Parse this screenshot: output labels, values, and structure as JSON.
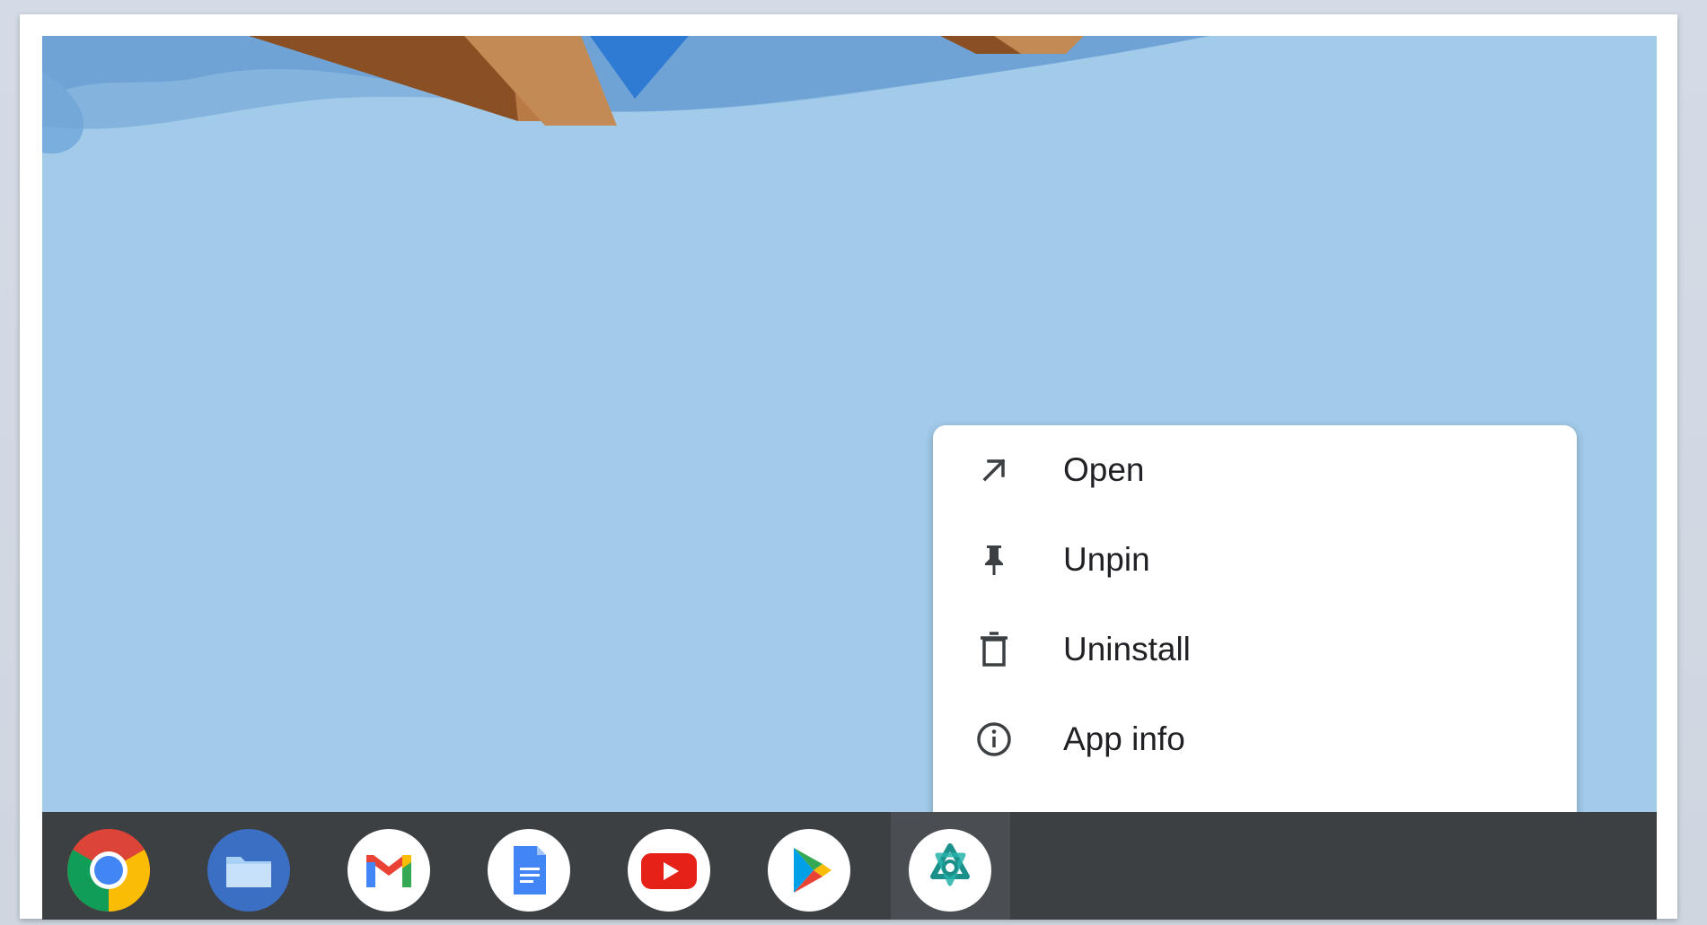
{
  "context_menu": {
    "items": [
      {
        "label": "Open",
        "icon": "open-arrow-icon"
      },
      {
        "label": "Unpin",
        "icon": "pin-icon"
      },
      {
        "label": "Uninstall",
        "icon": "trash-icon"
      },
      {
        "label": "App info",
        "icon": "info-icon"
      }
    ]
  },
  "shelf": {
    "apps": [
      {
        "name": "Chrome",
        "icon": "chrome-icon"
      },
      {
        "name": "Files",
        "icon": "files-icon"
      },
      {
        "name": "Gmail",
        "icon": "gmail-icon"
      },
      {
        "name": "Docs",
        "icon": "docs-icon"
      },
      {
        "name": "YouTube",
        "icon": "youtube-icon"
      },
      {
        "name": "Play Store",
        "icon": "play-store-icon"
      },
      {
        "name": "Selected app",
        "icon": "knot-app-icon"
      }
    ]
  },
  "colors": {
    "wallpaper_sky": "#a2cbea",
    "wallpaper_water": "#6fa3d6",
    "shelf_bg": "#3c4043",
    "menu_bg": "#ffffff"
  }
}
